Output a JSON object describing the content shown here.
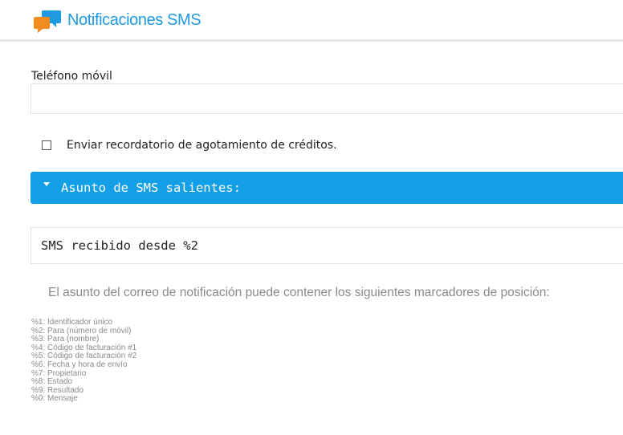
{
  "header": {
    "icon": "chat-bubbles-icon",
    "title": "Notificaciones SMS",
    "accent_color": "#1e9ae0"
  },
  "phone": {
    "label": "Teléfono móvil",
    "value": "",
    "placeholder": ""
  },
  "reminder_checkbox": {
    "label": "Enviar recordatorio de agotamiento de créditos.",
    "checked": false
  },
  "accordion": {
    "icon": "caret-down-icon",
    "title": "Asunto de SMS salientes:",
    "color": "#139fe6"
  },
  "subject": {
    "value": "SMS recibido desde %2"
  },
  "help": {
    "text": "El asunto del correo de notificación puede contener los siguientes marcadores de posición:"
  },
  "placeholders": [
    "%1: Identificador único",
    "%2: Para (número de móvil)",
    "%3: Para (nombre)",
    "%4: Código de facturación #1",
    "%5: Código de facturación #2",
    "%6: Fecha y hora de envío",
    "%7: Propietario",
    "%8: Estado",
    "%9: Resultado",
    "%0: Mensaje"
  ]
}
